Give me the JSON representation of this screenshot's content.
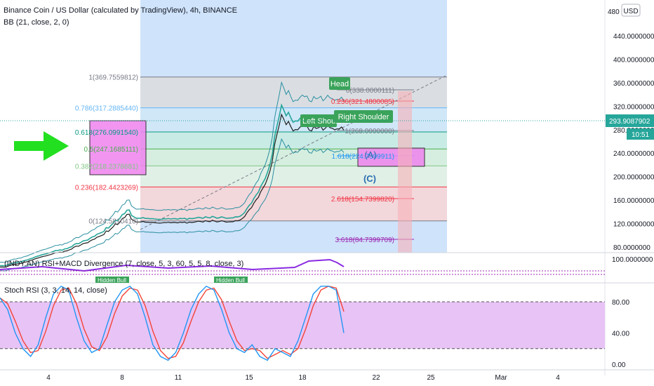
{
  "header": {
    "title": "Binance Coin / US Dollar (calculated by TradingView), 4h, BINANCE",
    "indicator": "BB (21, close, 2, 0)",
    "currency": "USD"
  },
  "chart_data": [
    {
      "type": "line",
      "title": "Binance Coin / US Dollar (calculated by TradingView), 4h, BINANCE",
      "ylim": [
        70,
        490
      ],
      "y_ticks": [
        "440.0000000",
        "400.0000000",
        "360.0000000",
        "320.0000000",
        "280.0000000",
        "240.0000000",
        "200.0000000",
        "160.0000000",
        "120.0000000",
        "80.0000000"
      ],
      "y_tick_values": [
        440,
        400,
        360,
        320,
        280,
        240,
        200,
        160,
        120,
        80
      ],
      "y_tick_top": "480",
      "x_ticks": [
        "4",
        "8",
        "11",
        "15",
        "18",
        "22",
        "25",
        "Mar",
        "4"
      ],
      "last_price": "293.9087902",
      "countdown": "10:51",
      "series": [
        {
          "x": [
            0,
            4,
            8,
            12,
            16,
            20,
            24,
            28,
            32,
            36,
            40,
            44,
            48,
            52,
            56,
            60,
            64,
            68,
            72,
            76,
            80,
            84,
            88,
            92,
            96,
            100,
            104,
            108,
            112,
            116,
            120,
            124,
            128,
            132,
            136,
            140,
            144,
            148,
            152,
            156,
            160,
            164,
            168,
            172,
            176,
            180,
            184,
            188,
            192,
            196,
            200,
            204,
            208,
            212,
            216,
            220,
            224,
            228,
            232,
            236,
            240,
            244,
            248,
            252,
            256,
            260,
            264,
            268,
            272,
            276,
            280,
            284,
            288,
            292,
            296,
            300,
            304,
            308,
            312,
            316,
            320,
            324,
            328,
            332,
            336,
            340,
            344,
            348,
            352,
            356,
            360,
            364,
            368,
            372,
            376,
            380,
            384,
            388,
            392,
            396,
            400,
            404,
            408,
            412,
            416,
            420,
            424,
            428,
            432,
            436,
            440,
            444,
            448,
            452,
            456,
            460,
            464,
            468,
            472,
            476,
            480,
            484,
            488,
            492,
            496,
            500,
            504,
            508,
            512,
            516,
            520,
            524,
            528,
            532,
            536,
            540,
            544,
            548,
            552,
            556,
            560,
            564,
            568,
            572,
            576,
            580,
            584,
            588,
            592,
            596
          ],
          "values": [
            48.3,
            48.4,
            48.0,
            49.2,
            50.6,
            51.9,
            53.2,
            53.2,
            54.4,
            54.6,
            56.3,
            57.3,
            58.1,
            60.0,
            60.9,
            62.7,
            64.1,
            65.2,
            66.6,
            67.6,
            68.4,
            69.8,
            70.8,
            72.2,
            73.9,
            74.0,
            75.1,
            74.5,
            76.9,
            77.3,
            79.2,
            80.4,
            83.8,
            85.9,
            85.6,
            87.8,
            90.4,
            91.3,
            91.9,
            95.0,
            97.2,
            98.4,
            101.8,
            103.2,
            104.8,
            106.6,
            113.1,
            112.3,
            116.6,
            120.3,
            125.9,
            124.6,
            129.4,
            135.4,
            136.9,
            142.8,
            143.1,
            134.0,
            131.6,
            129.1,
            129.2,
            129.2,
            130.1,
            128.8,
            128.8,
            128.2,
            128.4,
            127.9,
            127.4,
            127.2,
            127.3,
            128.2,
            127.9,
            128.6,
            127.7,
            128.4,
            128.3,
            127.5,
            128.8,
            128.3,
            129.0,
            127.0,
            128.9,
            128.3,
            128.8,
            129.6,
            130.7,
            129.9,
            129.0,
            131.6,
            130.3,
            129.6,
            132.3,
            130.9,
            129.2,
            129.9,
            131.4,
            130.4,
            128.9,
            129.3,
            129.5,
            129.7,
            131.5,
            131.3,
            132.5,
            135.3,
            138.9,
            145.6,
            151.2,
            155.0,
            162.6,
            168.8,
            173.6,
            183.4,
            190.3,
            197.4,
            208.3,
            220.9,
            238.8,
            267.6,
            285.8,
            302.8,
            321.9,
            313.4,
            303.6,
            309.6,
            300.3,
            292.6,
            295.0,
            294.5,
            299.2,
            302.7,
            300.1,
            301.3,
            293.9,
            292.5,
            300.6,
            297.0,
            298.1,
            301.0,
            293.9,
            297.5,
            302.4,
            298.3,
            297.2,
            294.6,
            296.1,
            296.1,
            299.5,
            293.9
          ]
        }
      ],
      "fibonacci": [
        {
          "label": "1(369.7559812)",
          "value": 369.7559812
        },
        {
          "label": "0.786(317.2885440)",
          "value": 317.288544
        },
        {
          "label": "0.618(276.0991540)",
          "value": 276.099154
        },
        {
          "label": "0.5(247.1685111)",
          "value": 247.1685111
        },
        {
          "label": "0.382(218.2378681)",
          "value": 218.2378681
        },
        {
          "label": "0.236(182.4423269)",
          "value": 182.4423269
        },
        {
          "label": "0(124.5810410)",
          "value": 124.581041
        }
      ],
      "projection": [
        {
          "label": "0(338.0000111)",
          "value": 338.0000111
        },
        {
          "label": "0.236(321.4800085)",
          "value": 321.4800085
        },
        {
          "label": "1(268.0000000)",
          "value": 268.0
        },
        {
          "label": "1.618(224.7399911)",
          "value": 224.7399911
        },
        {
          "label": "2.618(154.7399820)",
          "value": 154.739982
        },
        {
          "label": "3.618(84.7399709)",
          "value": 84.7399709
        }
      ],
      "annotations": [
        "Head",
        "Left Shoulder",
        "Right Shoulder",
        "(A)",
        "(C)"
      ]
    },
    {
      "type": "line",
      "title": "(INDY.AN) RSI+MACD Divergence (7, close, 5, 3, 60, 5, 5, 8, close, 3)",
      "y_ticks": [
        "100.0000000"
      ],
      "annotations": [
        "Hidden Bull",
        "Hidden Bull"
      ]
    },
    {
      "type": "line",
      "title": "Stoch RSI (3, 3, 14, 14, close)",
      "ylim": [
        0,
        100
      ],
      "y_ticks": [
        "80.00",
        "40.00",
        "0.00"
      ],
      "y_tick_values": [
        80,
        40,
        0
      ],
      "bands": [
        20,
        80
      ],
      "colors": {
        "k": "#2196f3",
        "d": "#f44336",
        "band": "#e8c3f5"
      }
    }
  ]
}
